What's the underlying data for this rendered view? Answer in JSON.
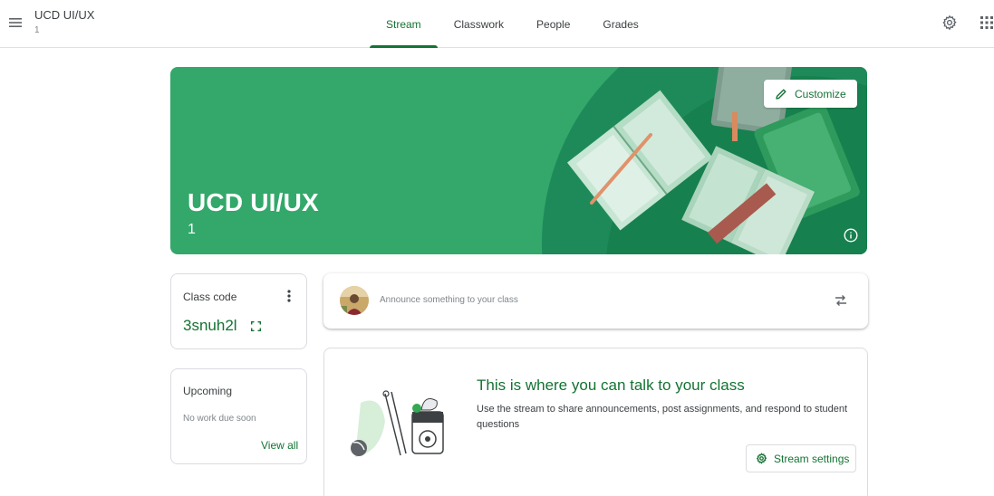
{
  "header": {
    "class_name": "UCD UI/UX",
    "class_section": "1",
    "tabs": [
      {
        "label": "Stream",
        "active": true
      },
      {
        "label": "Classwork",
        "active": false
      },
      {
        "label": "People",
        "active": false
      },
      {
        "label": "Grades",
        "active": false
      }
    ],
    "icons": {
      "menu": "hamburger-icon",
      "settings": "gear-icon",
      "apps": "apps-grid-icon"
    }
  },
  "banner": {
    "title": "UCD UI/UX",
    "section": "1",
    "customize_label": "Customize",
    "colors": {
      "background": "#33a86a",
      "accent": "#137333"
    }
  },
  "class_code": {
    "label": "Class code",
    "value": "3snuh2l"
  },
  "upcoming": {
    "label": "Upcoming",
    "empty_text": "No work due soon",
    "view_all": "View all"
  },
  "announce": {
    "placeholder": "Announce something to your class"
  },
  "stream_info": {
    "heading": "This is where you can talk to your class",
    "body": "Use the stream to share announcements, post assignments, and respond to student questions",
    "settings_label": "Stream settings"
  }
}
